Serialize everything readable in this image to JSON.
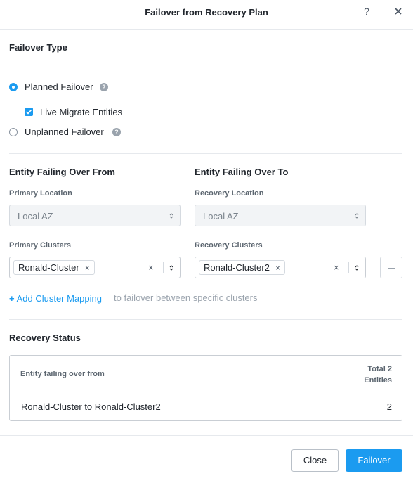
{
  "dialog": {
    "title": "Failover from Recovery Plan",
    "help_glyph": "?"
  },
  "failover_type": {
    "title": "Failover Type",
    "options": [
      {
        "label": "Planned Failover",
        "selected": true
      },
      {
        "label": "Unplanned Failover",
        "selected": false
      }
    ],
    "live_migrate": {
      "label": "Live Migrate Entities",
      "checked": true
    }
  },
  "from": {
    "title": "Entity Failing Over From",
    "location_label": "Primary Location",
    "location_value": "Local AZ",
    "clusters_label": "Primary Clusters",
    "cluster_tag": "Ronald-Cluster"
  },
  "to": {
    "title": "Entity Failing Over To",
    "location_label": "Recovery Location",
    "location_value": "Local AZ",
    "clusters_label": "Recovery Clusters",
    "cluster_tag": "Ronald-Cluster2"
  },
  "add_mapping": {
    "plus": "+",
    "link": "Add Cluster Mapping",
    "hint": "to failover between specific clusters"
  },
  "recovery_status": {
    "title": "Recovery Status",
    "col1_header": "Entity failing over from",
    "col2_header_line1": "Total 2",
    "col2_header_line2": "Entities",
    "row": {
      "from": "Ronald-Cluster to Ronald-Cluster2",
      "count": "2"
    }
  },
  "footer": {
    "close_label": "Close",
    "failover_label": "Failover"
  },
  "colors": {
    "accent": "#1b9bf0",
    "text": "#22272e",
    "muted": "#9aa3ad"
  },
  "icons": {
    "help": "question-circle-icon",
    "close": "close-icon",
    "remove": "minus-icon",
    "select": "chevron-up-down-icon"
  }
}
